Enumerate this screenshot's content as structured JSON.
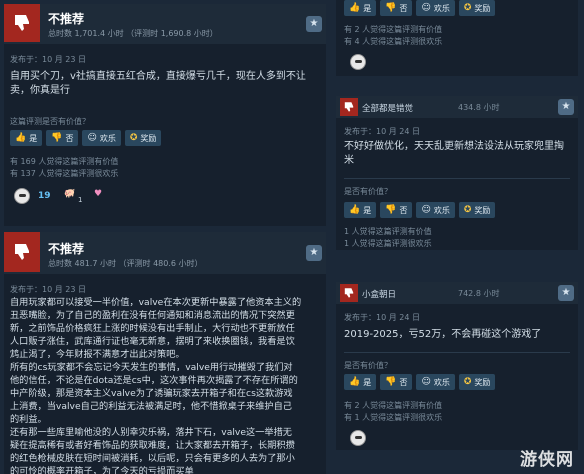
{
  "review1": {
    "verdict": "不推荐",
    "hours": "总时数 1,701.4 小时 （评测时 1,690.8 小时）",
    "date": "发布于：10 月 23 日",
    "body": "自用买个刀，v社搞直接五红合成，直接爆亏几千，现在人多到不让\n卖，你真是行",
    "helpful_q": "这篇评测是否有价值？",
    "buttons": {
      "yes": "是",
      "no": "否",
      "funny": "欢乐",
      "award": "奖励"
    },
    "count_helpful": "有 169 人觉得这篇评测有价值",
    "count_funny": "有 137 人觉得这篇评测很欢乐",
    "reaction_count": "19",
    "reaction2_count": "1"
  },
  "review2": {
    "verdict": "不推荐",
    "hours": "总时数 481.7 小时 （评测时 480.6 小时）",
    "date": "发布于：10 月 23 日",
    "body": "自用玩家都可以接受一半价值，valve在本次更新中暴露了他资本主义的\n丑恶嘴脸，为了自己的盈利在没有任何通知和消息流出的情况下突然更\n新，之前饰品价格疯狂上涨的时候没有出手制止，大行动也不更新放任\n人口贩子涨住，武库通行证也毫无新意，摆明了来收换圈钱，我看是饮\n鸩止渴了，今年财报不满意才出此对策吧。\n所有的cs玩家都不会忘记今天发生的事情，valve用行动摧毁了我们对\n他的信任，不论是在dota还是cs中，这次事件再次揭露了不存在所谓的\n中产阶级，那是资本主义valve为了诱骗玩家去开箱子和在cs这款游戏\n上消费，当valve自己的利益无法被满足时，他不惜掀桌子来维护自己\n的利益。\n还有那一些库里喻他没的人别幸灾乐祸，落井下石，valve这一举措无\n疑在提高稀有或者好看饰品的获取难度，让大家都去开箱子，长期积攒\n的红色枪械皮肤在短时间被消耗，以后呢，只会有更多的人去为了那小\n的可怜的概率开箱子，为了今天的亏损而买单"
  },
  "right1": {
    "count_helpful": "有 2 人觉得这篇评测有价值",
    "count_funny": "有 4 人觉得这篇评测很欢乐",
    "buttons": {
      "yes": "是",
      "no": "否",
      "funny": "欢乐",
      "award": "奖励"
    }
  },
  "right2": {
    "user": "全部都是错觉",
    "hours": "434.8 小时",
    "date": "发布于：10 月 24 日",
    "body": "不好好做优化，天天乱更新想法设法从玩家兜里掏\n米",
    "helpful_q": "是否有价值？",
    "buttons": {
      "yes": "是",
      "no": "否",
      "funny": "欢乐",
      "award": "奖励"
    },
    "count_helpful": "1 人觉得这篇评测有价值",
    "count_funny": "1 人觉得这篇评测很欢乐"
  },
  "right3": {
    "user": "小盒朝日",
    "hours": "742.8 小时",
    "date": "发布于：10 月 24 日",
    "body": "2019-2025，亏52万，不会再碰这个游戏了",
    "helpful_q": "是否有价值？",
    "buttons": {
      "yes": "是",
      "no": "否",
      "funny": "欢乐",
      "award": "奖励"
    },
    "count_helpful": "有 2 人觉得这篇评测有价值",
    "count_funny": "有 1 人觉得这篇评测很欢乐"
  },
  "watermark": "游侠网",
  "colors": {
    "thumbs_down": "#a3271f",
    "button": "#2a475e",
    "award": "#f5c542"
  }
}
